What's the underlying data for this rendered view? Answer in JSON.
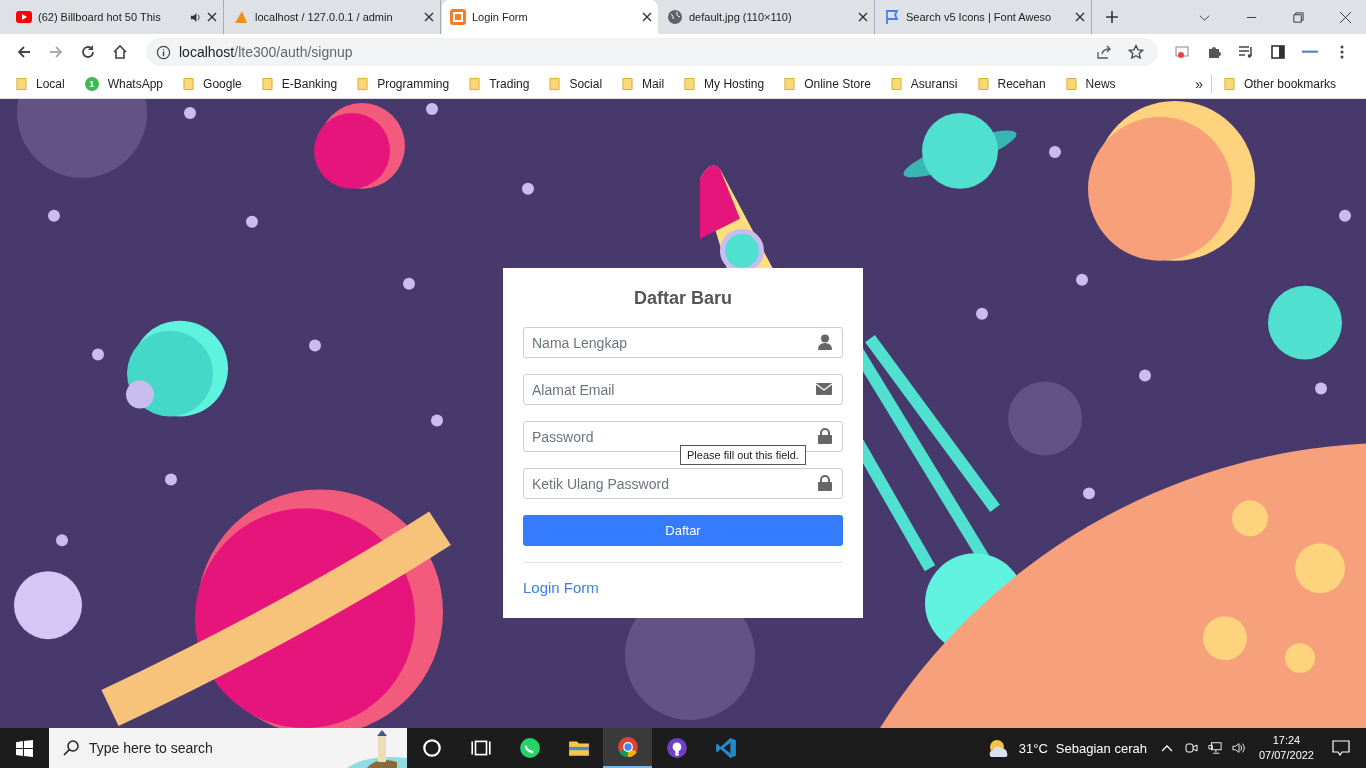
{
  "browser": {
    "tabs": [
      {
        "title": "(62) Billboard hot 50 This",
        "selected": false,
        "audio": true
      },
      {
        "title": "localhost / 127.0.0.1 / admin",
        "selected": false,
        "audio": false
      },
      {
        "title": "Login Form",
        "selected": true,
        "audio": false
      },
      {
        "title": "default.jpg (110×110)",
        "selected": false,
        "audio": false
      },
      {
        "title": "Search v5 Icons | Font Aweso",
        "selected": false,
        "audio": false
      }
    ],
    "address": {
      "host": "localhost",
      "path": "/lte300/auth/signup"
    },
    "bookmarks": [
      {
        "label": "Local",
        "kind": "folder"
      },
      {
        "label": "WhatsApp",
        "kind": "app",
        "badge": "1"
      },
      {
        "label": "Google",
        "kind": "folder"
      },
      {
        "label": "E-Banking",
        "kind": "folder"
      },
      {
        "label": "Programming",
        "kind": "folder"
      },
      {
        "label": "Trading",
        "kind": "folder"
      },
      {
        "label": "Social",
        "kind": "folder"
      },
      {
        "label": "Mail",
        "kind": "folder"
      },
      {
        "label": "My Hosting",
        "kind": "folder"
      },
      {
        "label": "Online Store",
        "kind": "folder"
      },
      {
        "label": "Asuransi",
        "kind": "folder"
      },
      {
        "label": "Recehan",
        "kind": "folder"
      },
      {
        "label": "News",
        "kind": "folder"
      }
    ],
    "more_bookmarks": "»",
    "other_bookmarks": "Other bookmarks"
  },
  "form": {
    "title": "Daftar Baru",
    "fields": [
      {
        "placeholder": "Nama Lengkap",
        "kind": "user"
      },
      {
        "placeholder": "Alamat Email",
        "kind": "email"
      },
      {
        "placeholder": "Password",
        "kind": "lock"
      },
      {
        "placeholder": "Ketik Ulang Password",
        "kind": "lock"
      }
    ],
    "tooltip": "Please fill out this field.",
    "submit": "Daftar",
    "link": "Login Form"
  },
  "taskbar": {
    "search_placeholder": "Type here to search",
    "apps": [
      {
        "kind": "cortana",
        "selected": false
      },
      {
        "kind": "taskview",
        "selected": false
      },
      {
        "kind": "whatsapp",
        "selected": false
      },
      {
        "kind": "files",
        "selected": false
      },
      {
        "kind": "chrome",
        "selected": true
      },
      {
        "kind": "github",
        "selected": false
      },
      {
        "kind": "vscode",
        "selected": false
      }
    ],
    "temperature": "31°C",
    "weather": "Sebagian cerah",
    "time": "17:24",
    "date": "07/07/2022"
  }
}
